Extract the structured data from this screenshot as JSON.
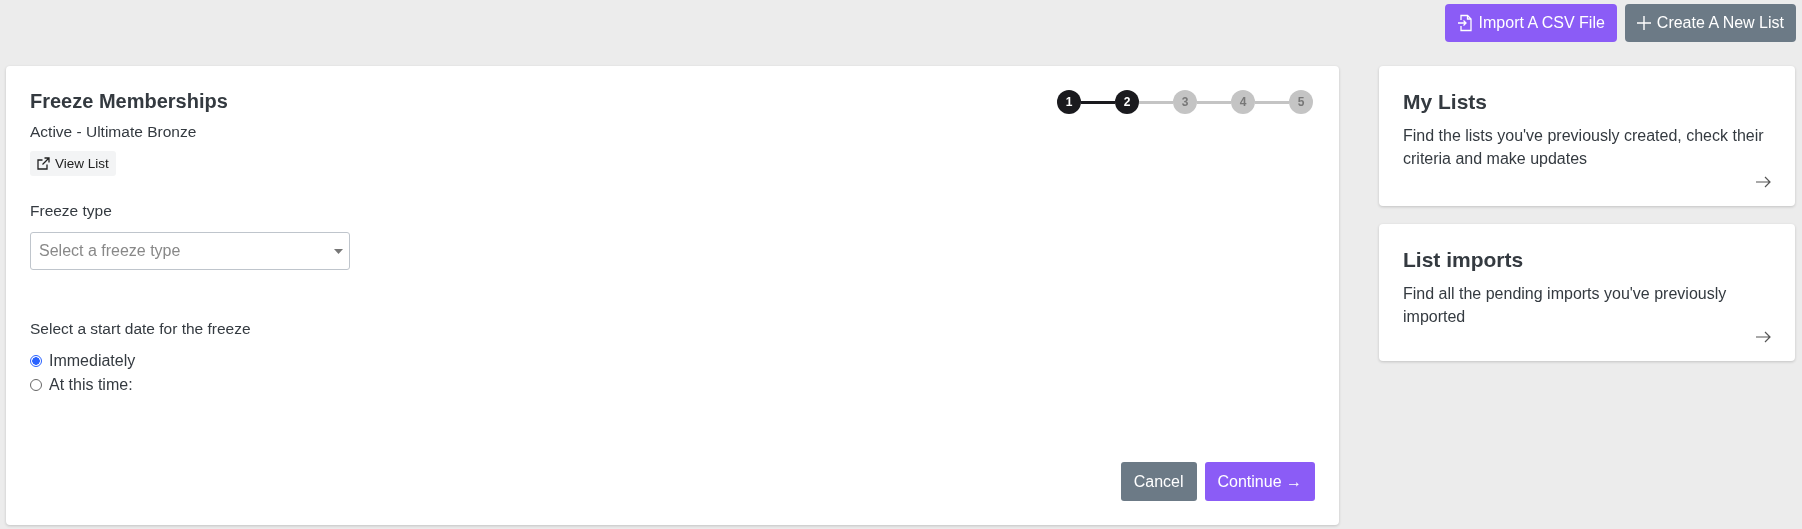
{
  "top_actions": [
    {
      "kind": "import",
      "label": "Import A CSV File"
    },
    {
      "kind": "create",
      "label": "Create A New List"
    }
  ],
  "form": {
    "title": "Freeze Memberships",
    "subtitle": "Active - Ultimate Bronze",
    "view_link": "View List",
    "steps": [
      {
        "label": "1",
        "active": true
      },
      {
        "label": "2",
        "active": true
      },
      {
        "label": "3",
        "active": false
      },
      {
        "label": "4",
        "active": false
      },
      {
        "label": "5",
        "active": false
      }
    ],
    "freeze_type": {
      "label": "Freeze type",
      "placeholder": "Select a freeze type"
    },
    "start_date": {
      "label": "Select a start date for the freeze",
      "options": [
        {
          "label": "Immediately",
          "selected": true
        },
        {
          "label": "At this time:",
          "selected": false
        }
      ]
    },
    "buttons": [
      {
        "kind": "secondary",
        "label": "Cancel"
      },
      {
        "kind": "primary",
        "label": "Continue →"
      }
    ]
  },
  "side_cards": [
    {
      "title": "My Lists",
      "description": "Find the lists you've previously created, check their criteria and make updates"
    },
    {
      "title": "List imports",
      "description": "Find all the pending imports you've previously imported"
    }
  ]
}
